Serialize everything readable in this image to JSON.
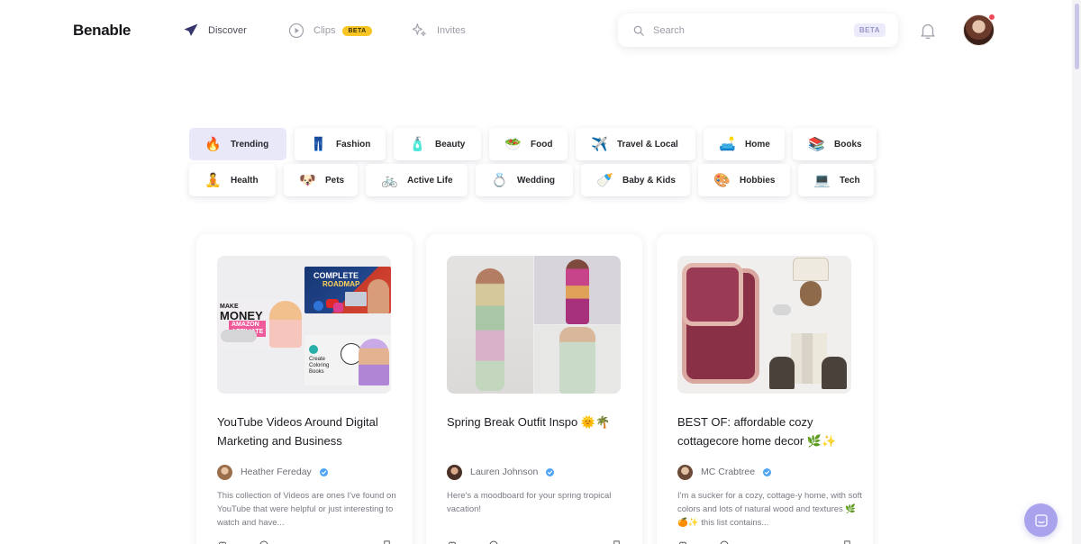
{
  "app": {
    "logo": "Benable"
  },
  "nav": {
    "discover": "Discover",
    "clips": "Clips",
    "clips_badge": "BETA",
    "invites": "Invites"
  },
  "search": {
    "placeholder": "Search",
    "badge": "BETA"
  },
  "colors": {
    "accent": "#5f56c9",
    "beta_yellow": "#f7c625",
    "active_chip_bg": "#e9e8f8",
    "verified": "#4fa5f5",
    "chat_fab": "#a8a3ec"
  },
  "categories": {
    "row1": [
      {
        "emoji": "🔥",
        "label": "Trending",
        "active": true
      },
      {
        "emoji": "👖",
        "label": "Fashion"
      },
      {
        "emoji": "🧴",
        "label": "Beauty"
      },
      {
        "emoji": "🥗",
        "label": "Food"
      },
      {
        "emoji": "✈️",
        "label": "Travel & Local"
      },
      {
        "emoji": "🛋️",
        "label": "Home"
      },
      {
        "emoji": "📚",
        "label": "Books"
      }
    ],
    "row2": [
      {
        "emoji": "🧘",
        "label": "Health"
      },
      {
        "emoji": "🐶",
        "label": "Pets"
      },
      {
        "emoji": "🚲",
        "label": "Active Life"
      },
      {
        "emoji": "💍",
        "label": "Wedding"
      },
      {
        "emoji": "🍼",
        "label": "Baby & Kids"
      },
      {
        "emoji": "🎨",
        "label": "Hobbies"
      },
      {
        "emoji": "💻",
        "label": "Tech"
      }
    ]
  },
  "cards": [
    {
      "title": "YouTube Videos Around Digital Marketing and Business",
      "author": "Heather Fereday",
      "description": "This collection of Videos are ones I've found on YouTube that were helpful or just interesting to watch and have...",
      "collage_text": {
        "complete": "COMPLETE",
        "roadmap": "ROADMAP",
        "make": "MAKE",
        "money": "MONEY",
        "amazon": "AMAZON",
        "affiliate": "AFFILIATE",
        "create_coloring_books": "Create Coloring Books"
      }
    },
    {
      "title": "Spring Break Outfit Inspo 🌞🌴",
      "author": "Lauren Johnson",
      "description": "Here's a moodboard for your spring tropical vacation!"
    },
    {
      "title": "BEST OF: affordable cozy cottagecore home decor 🌿✨",
      "author": "MC Crabtree",
      "description": "I'm a sucker for a cozy, cottage-y home, with soft colors and lots of natural wood and textures 🌿🍊✨ this list contains..."
    }
  ]
}
